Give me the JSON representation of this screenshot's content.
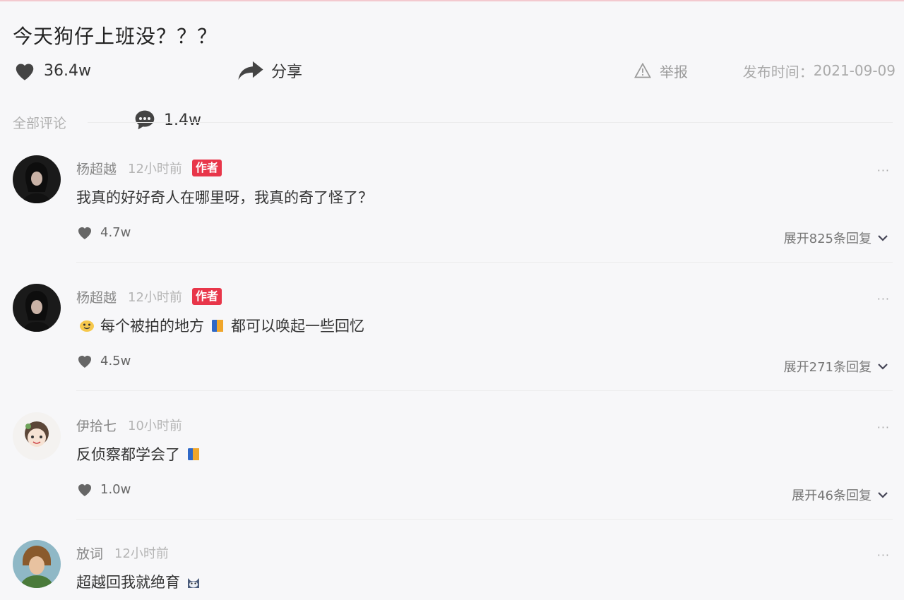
{
  "post": {
    "title": "今天狗仔上班没？？？",
    "likes": "36.4w",
    "comments": "1.4w",
    "share_label": "分享",
    "report_label": "举报",
    "publish_label": "发布时间：",
    "publish_date": "2021-09-09"
  },
  "comments_section": {
    "label": "全部评论",
    "items": [
      {
        "user": "杨超越",
        "time": "12小时前",
        "badge": "作者",
        "text_a": "我真的好好奇人在哪里呀，我真的奇了怪了？",
        "likes": "4.7w",
        "expand": "展开825条回复",
        "more": "···"
      },
      {
        "user": "杨超越",
        "time": "12小时前",
        "badge": "作者",
        "text_a": "每个被拍的地方",
        "text_b": "都可以唤起一些回忆",
        "likes": "4.5w",
        "expand": "展开271条回复",
        "more": "···"
      },
      {
        "user": "伊拾七",
        "time": "10小时前",
        "text_a": "反侦察都学会了",
        "likes": "1.0w",
        "expand": "展开46条回复",
        "more": "···"
      },
      {
        "user": "放词",
        "time": "12小时前",
        "text_a": "超越回我就绝育",
        "more": "···"
      }
    ]
  },
  "icons": {
    "like": "heart-icon",
    "comment": "comment-bubble-icon",
    "share": "share-arrow-icon",
    "report": "warning-triangle-icon",
    "expand": "chevron-down-icon"
  },
  "colors": {
    "badge": "#e8364a",
    "background": "#f7f7f9"
  }
}
